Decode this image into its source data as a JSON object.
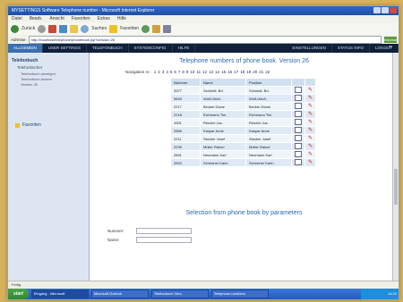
{
  "window": {
    "title": "MYSETTINGS Software Telephone number - Microsoft Internet Explorer"
  },
  "menu": {
    "items": [
      "Datei",
      "Bearb.",
      "Ansicht",
      "Favoriten",
      "Extras",
      "Hilfe"
    ]
  },
  "toolbar": {
    "back_label": "Zurück",
    "search_label": "Suchen",
    "favorites_label": "Favoriten"
  },
  "address": {
    "label": "Adresse",
    "url": "http://localhost/telephone/phonebook.jsp?version=26",
    "go_label": "Wechseln zu"
  },
  "nav": {
    "left": [
      "ALLGEMEIN",
      "USER SETTINGS",
      "TELEFONBUCH",
      "SYSTEMCONFIG",
      "HILFE"
    ],
    "right": [
      "EINSTELLUNGEN",
      "STATUS INFO",
      "LOGOUT"
    ]
  },
  "sidebar": {
    "section": "Telefonbuch",
    "group": "Telefonbücher",
    "items": [
      "Telefonbuch anzeigen",
      "Telefonbuch ändern",
      "Version 26"
    ],
    "prefs_label": "Favoriten"
  },
  "main": {
    "title": "Telephone numbers of phone book. Version 26",
    "nav_label": "Navigation nr.:",
    "pages": [
      "1",
      "2",
      "3",
      "4",
      "5",
      "6",
      "7",
      "8",
      "9",
      "10",
      "11",
      "12",
      "13",
      "14",
      "15",
      "16",
      "17",
      "18",
      "19",
      "20",
      "21",
      "22"
    ],
    "columns": [
      "Nummer",
      "Name",
      "Position"
    ],
    "rows": [
      [
        "3377",
        "Schmidt. Bd.",
        "Schmidt. Bd."
      ],
      [
        "9834",
        "Wolf-Ulrich",
        "Wolf-Ulrich"
      ],
      [
        "2217",
        "Becker Diane",
        "Becker Diane"
      ],
      [
        "2218",
        "Eichmann Tim",
        "Eichmann Tim"
      ],
      [
        "4301",
        "Reichel Jos.",
        "Reichel Jos."
      ],
      [
        "2866",
        "Kaspar Anne",
        "Kaspar Anne"
      ],
      [
        "2211",
        "Stocker Josef",
        "Stocker Josef"
      ],
      [
        "2235",
        "Müller Rainer",
        "Müller Rainer"
      ],
      [
        "2891",
        "Neumann Karl",
        "Neumann Karl"
      ],
      [
        "2893",
        "Schreiner Karin",
        "Schreiner Karin"
      ]
    ],
    "selection_title": "Selection from phone book by parameters",
    "field1_label": "Nummer:",
    "field2_label": "Name:"
  },
  "statusbar": {
    "text": "Fertig"
  },
  "taskbar": {
    "start_label": "start",
    "tasks": [
      "Eingang - Microsoft",
      "Microsoft Outlook",
      "Telefonbuch Vers.",
      "Telephone numbers"
    ],
    "clock": "14:22"
  }
}
